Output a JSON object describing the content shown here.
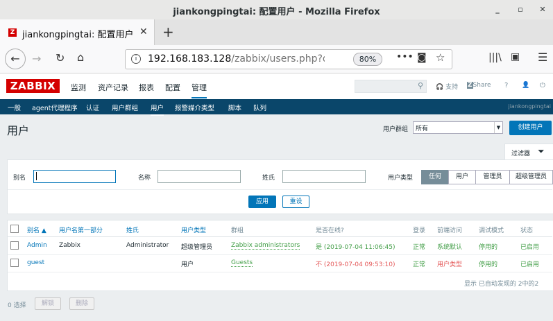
{
  "window": {
    "title": "jiankongpingtai: 配置用户 - Mozilla Firefox",
    "minimize": "_",
    "maximize": "▫",
    "close": "✕"
  },
  "tab": {
    "favicon": "Z",
    "title": "jiankongpingtai: 配置用户",
    "close": "✕",
    "new_tab": "+"
  },
  "nav": {
    "url_host": "192.168.183.128",
    "url_path": "/zabbix/users.php?ddre",
    "zoom": "80%"
  },
  "header": {
    "logo": "ZABBIX",
    "menu": [
      "监测",
      "资产记录",
      "报表",
      "配置",
      "管理"
    ],
    "support": "支持",
    "share": "Share",
    "help": "?",
    "user": "👤",
    "power": "⏻"
  },
  "submenu": {
    "items": [
      "一般",
      "agent代理程序",
      "认证",
      "用户群组",
      "用户",
      "报警媒介类型",
      "脚本",
      "队列"
    ],
    "right_text": "jiankongpingtai"
  },
  "page": {
    "title": "用户",
    "group_label": "用户群组",
    "group_value": "所有",
    "create_button": "创建用户"
  },
  "filter": {
    "tab_label": "过滤器",
    "alias_label": "别名",
    "name_label": "名称",
    "surname_label": "姓氏",
    "type_label": "用户类型",
    "type_options": [
      "任何",
      "用户",
      "管理员",
      "超级管理员"
    ],
    "apply": "应用",
    "reset": "重设"
  },
  "table": {
    "headers": [
      "别名 ▲",
      "用户名第一部分",
      "姓氏",
      "用户类型",
      "群组",
      "是否在线?",
      "登录",
      "前端访问",
      "调试模式",
      "状态"
    ],
    "rows": [
      {
        "alias": "Admin",
        "name": "Zabbix",
        "surname": "Administrator",
        "type": "超级管理员",
        "group": "Zabbix administrators",
        "online": "是 (2019-07-04 11:06:45)",
        "login": "正常",
        "frontend": "系统默认",
        "debug": "停用的",
        "status": "已启用"
      },
      {
        "alias": "guest",
        "name": "",
        "surname": "",
        "type": "用户",
        "group": "Guests",
        "online": "不 (2019-07-04 09:53:10)",
        "login": "正常",
        "frontend": "用户类型",
        "debug": "停用的",
        "status": "已启用"
      }
    ],
    "summary": "显示 已自动发现的 2中的2"
  },
  "footer": {
    "selected": "0 选择",
    "unlock": "解锁",
    "delete": "删除"
  },
  "colors": {
    "brand": "#d40000",
    "accent": "#0275b8",
    "submenu": "#0a466a",
    "green": "#429e47",
    "red": "#e45959"
  }
}
